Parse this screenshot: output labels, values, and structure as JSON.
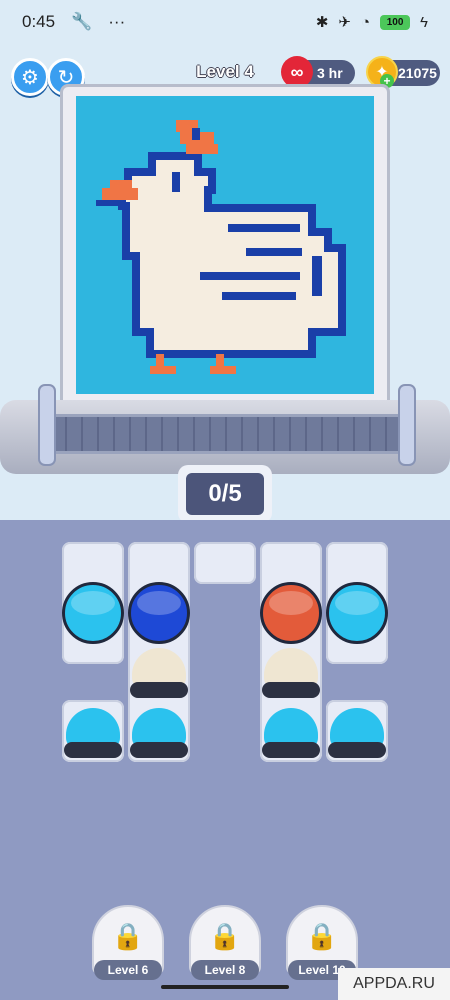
{
  "status_bar": {
    "time": "0:45",
    "battery": "100"
  },
  "header": {
    "level_title": "Level 4",
    "lives_text": "3 hr",
    "coins_value": "21075",
    "settings_icon": "gear-icon",
    "restart_icon": "restart-icon"
  },
  "puzzle": {
    "progress_text": "0/5",
    "image_subject": "pixel-art duck"
  },
  "lanes": [
    {
      "top_pot_color": "#2bc2ee",
      "bottom_ball_color": "#2bc2ee"
    },
    {
      "top_pot_color": "#1e49d6",
      "middle_ball_color": "#efe6d2",
      "bottom_ball_color": "#2bc2ee"
    },
    {},
    {
      "top_pot_color": "#e35b3a",
      "middle_ball_color": "#efe6d2",
      "bottom_ball_color": "#2bc2ee"
    },
    {
      "top_pot_color": "#2bc2ee",
      "bottom_ball_color": "#2bc2ee"
    }
  ],
  "locked_levels": [
    {
      "label": "Level 6"
    },
    {
      "label": "Level 8"
    },
    {
      "label": "Level 10"
    }
  ],
  "watermark": "APPDA.RU",
  "colors": {
    "sky": "#2fb6df",
    "duck_body": "#f5ede0",
    "duck_outline": "#1a3fa8",
    "beak": "#f07545",
    "accent": "#3a9ef0"
  }
}
